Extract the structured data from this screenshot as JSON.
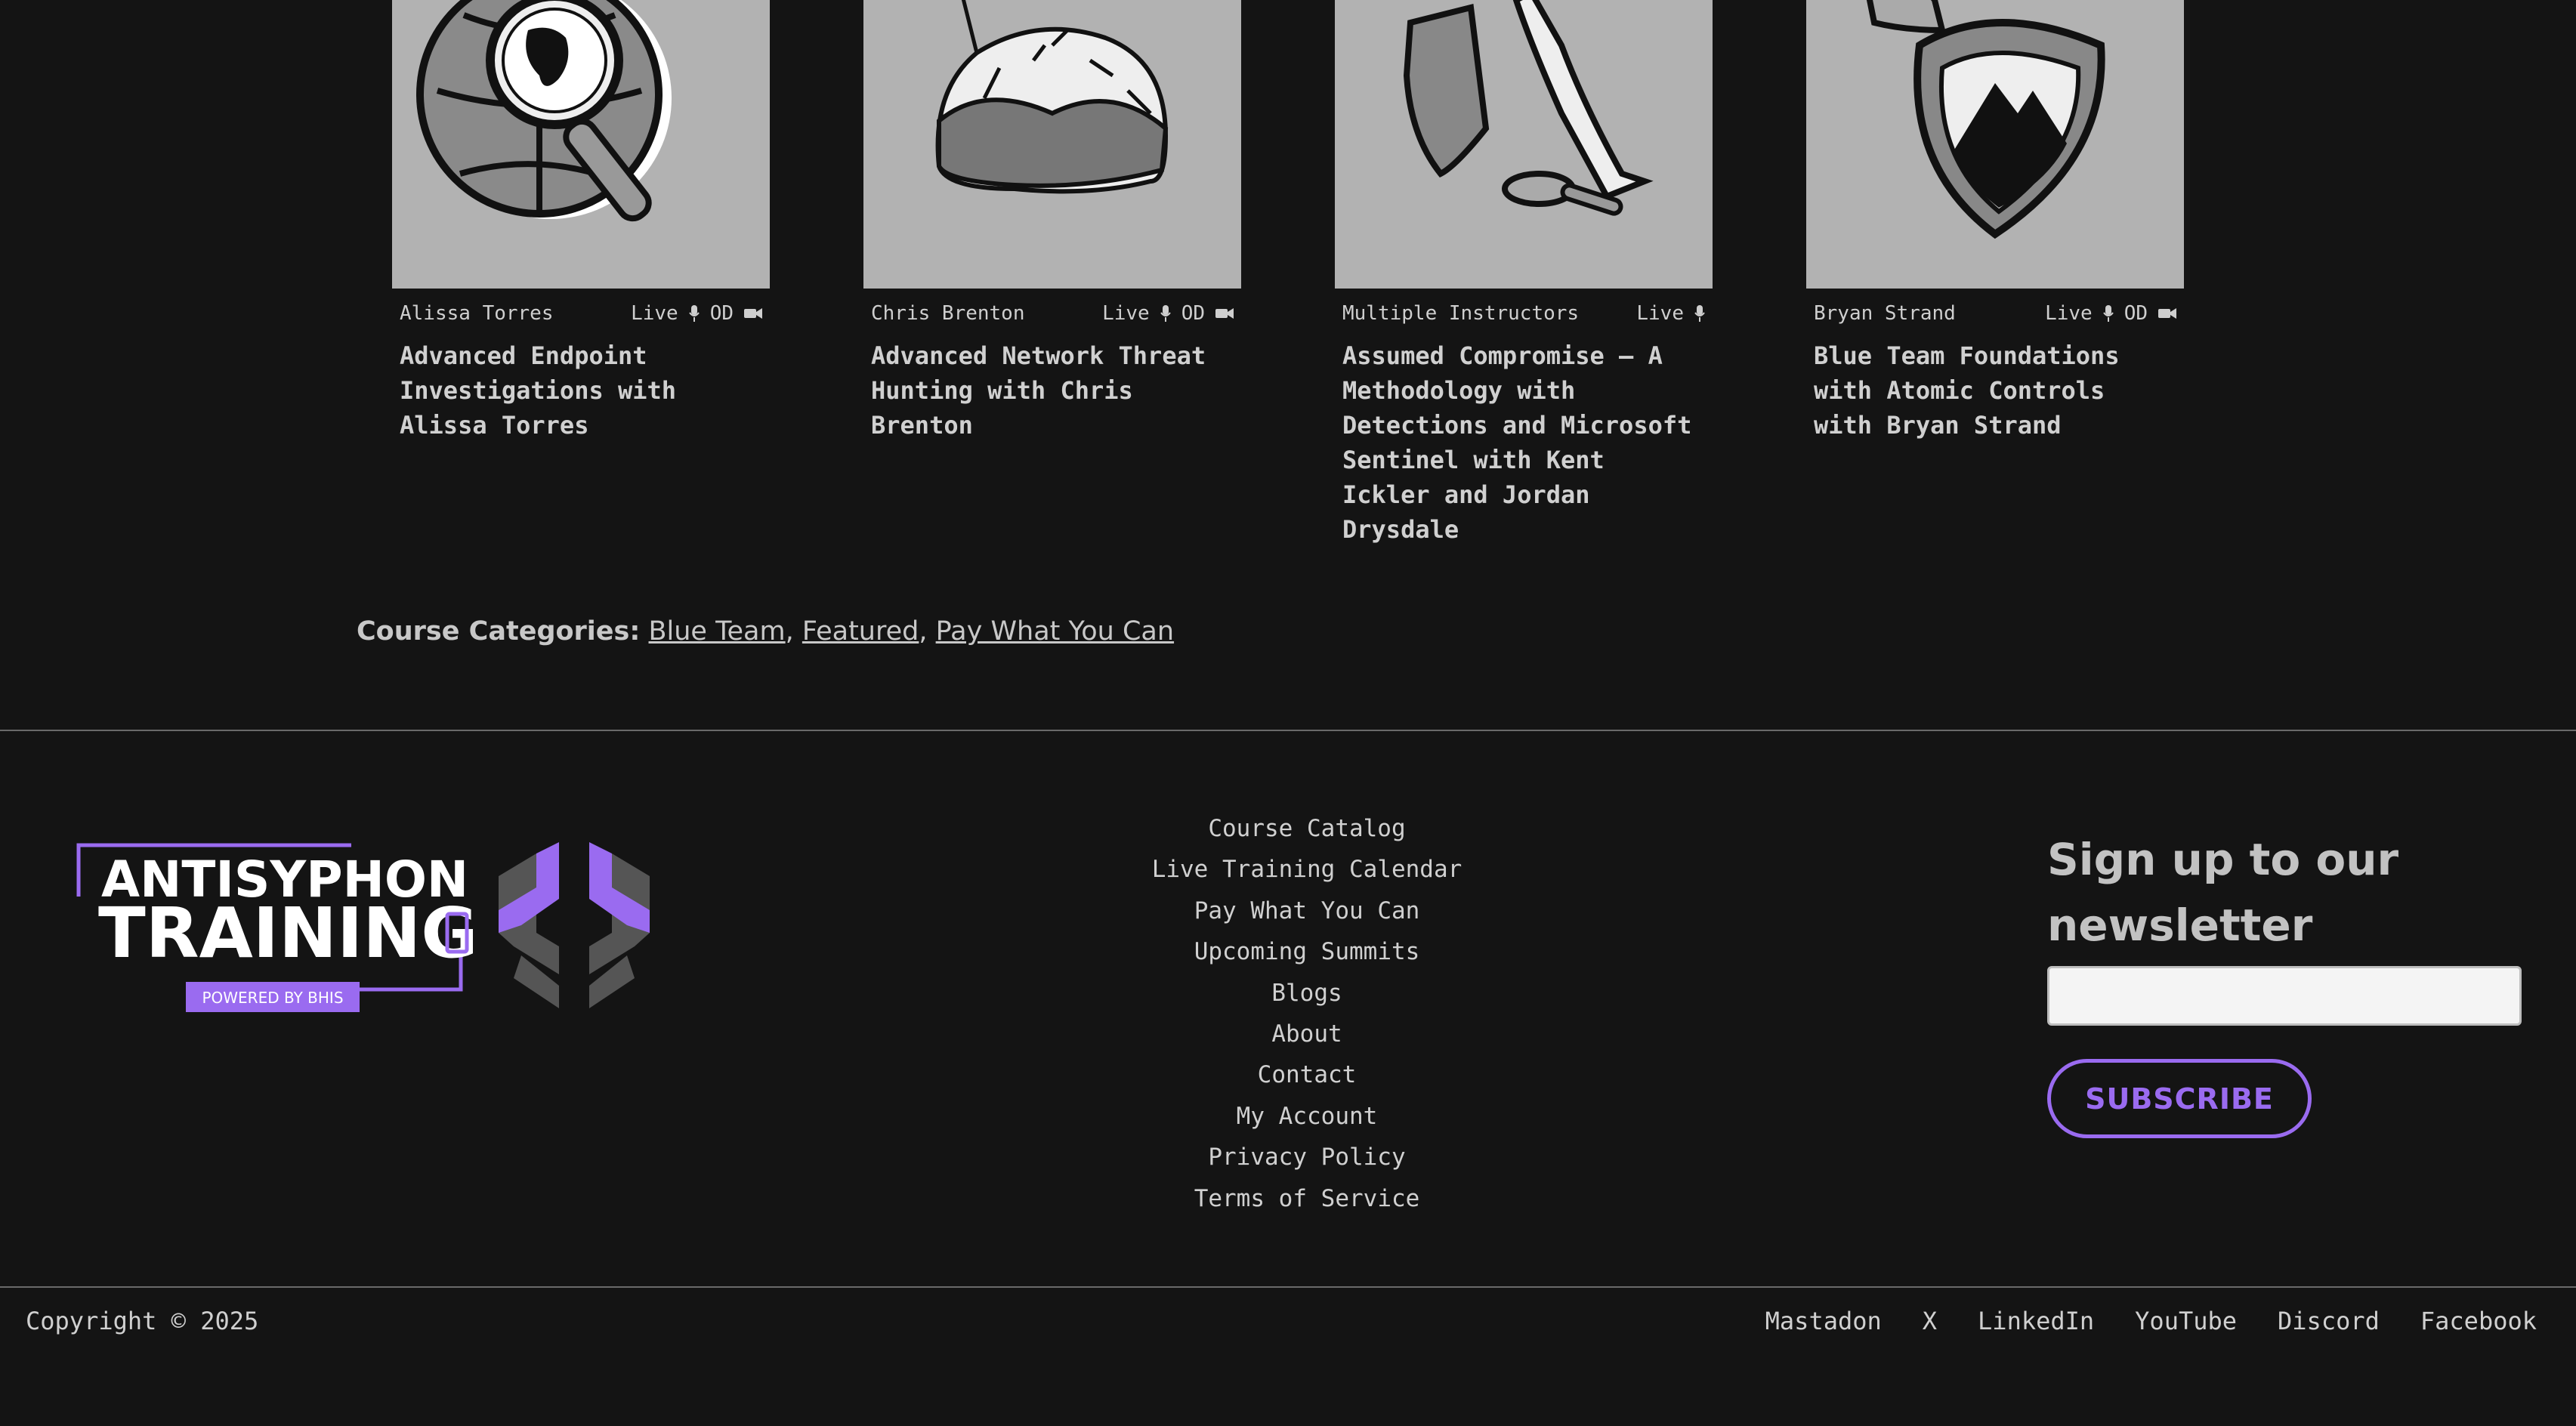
{
  "courses": [
    {
      "instructor": "Alissa Torres",
      "badges": [
        "Live",
        "OD"
      ],
      "title": "Advanced Endpoint Investigations with Alissa Torres",
      "illustration": "globe-magnifier-icon"
    },
    {
      "instructor": "Chris Brenton",
      "badges": [
        "Live",
        "OD"
      ],
      "title": "Advanced Network Threat Hunting with Chris Brenton",
      "illustration": "haystack-icon"
    },
    {
      "instructor": "Multiple Instructors",
      "badges": [
        "Live"
      ],
      "title": "Assumed Compromise – A Methodology with Detections and Microsoft Sentinel with Kent Ickler and Jordan Drysdale",
      "illustration": "shield-sword-icon"
    },
    {
      "instructor": "Bryan Strand",
      "badges": [
        "Live",
        "OD"
      ],
      "title": "Blue Team Foundations with Atomic Controls with Bryan Strand",
      "illustration": "knight-shield-icon"
    }
  ],
  "categories": {
    "label": "Course Categories:",
    "items": [
      "Blue Team",
      "Featured",
      "Pay What You Can"
    ]
  },
  "logo": {
    "line1": "ANTISYPHON",
    "line2": "TRAINING",
    "tagline": "POWERED BY BHIS"
  },
  "footer_nav": [
    "Course Catalog",
    "Live Training Calendar",
    "Pay What You Can",
    "Upcoming Summits",
    "Blogs",
    "About",
    "Contact",
    "My Account",
    "Privacy Policy",
    "Terms of Service"
  ],
  "newsletter": {
    "heading": "Sign up to our newsletter",
    "email_value": "",
    "button": "SUBSCRIBE"
  },
  "copyright": "Copyright © 2025",
  "socials": [
    "Mastadon",
    "X",
    "LinkedIn",
    "YouTube",
    "Discord",
    "Facebook"
  ],
  "colors": {
    "background": "#141414",
    "accent": "#9a6bf0",
    "card_image": "#b2b2b2"
  }
}
